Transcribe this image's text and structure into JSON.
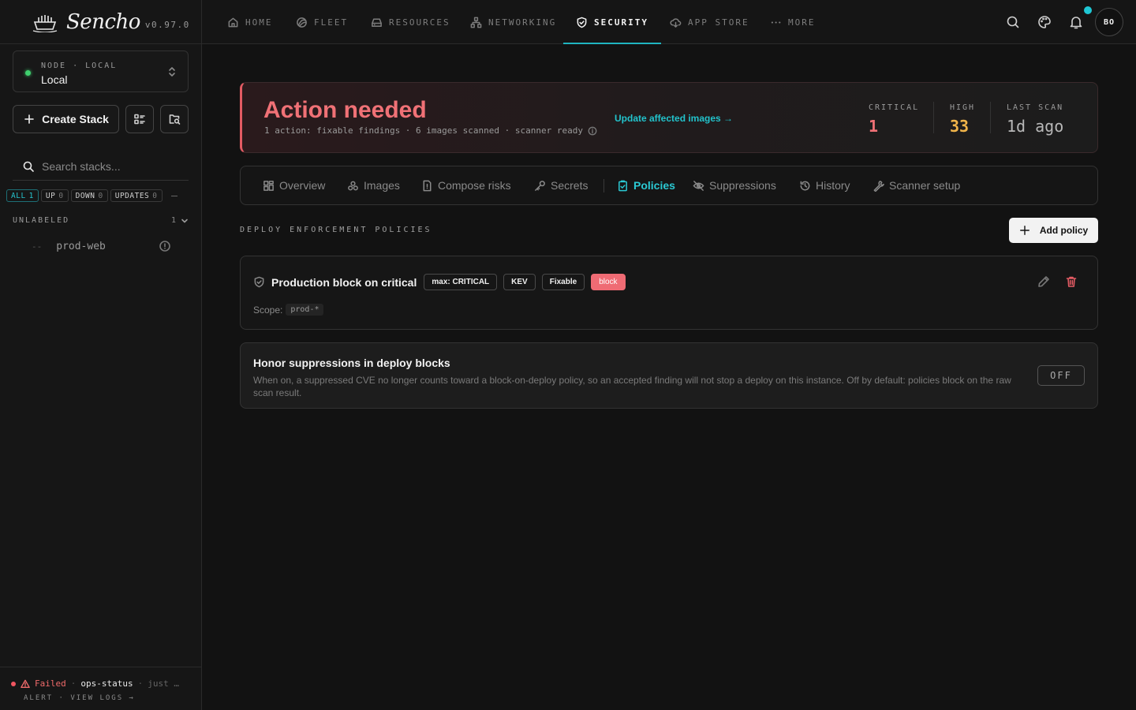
{
  "brand": {
    "name": "Sencho",
    "version": "v0.97.0"
  },
  "node": {
    "label": "NODE · LOCAL",
    "value": "Local"
  },
  "sidebar": {
    "create_label": "Create Stack",
    "search_placeholder": "Search stacks...",
    "filters": [
      {
        "label": "ALL",
        "count": "1"
      },
      {
        "label": "UP",
        "count": "0"
      },
      {
        "label": "DOWN",
        "count": "0"
      },
      {
        "label": "UPDATES",
        "count": "0"
      }
    ],
    "group": {
      "label": "UNLABELED",
      "count": "1"
    },
    "stacks": [
      {
        "dash": "--",
        "name": "prod-web"
      }
    ],
    "footer": {
      "status": "Failed",
      "sep": "·",
      "name": "ops-status",
      "time": "just …",
      "actions": "ALERT · VIEW LOGS →"
    }
  },
  "nav": {
    "items": [
      {
        "label": "HOME",
        "icon": "home-icon"
      },
      {
        "label": "FLEET",
        "icon": "fleet-icon"
      },
      {
        "label": "RESOURCES",
        "icon": "resources-icon"
      },
      {
        "label": "NETWORKING",
        "icon": "networking-icon"
      },
      {
        "label": "SECURITY",
        "icon": "shield-icon"
      },
      {
        "label": "APP STORE",
        "icon": "cloud-download-icon"
      },
      {
        "label": "MORE",
        "icon": "dots-icon"
      }
    ],
    "active": "SECURITY",
    "avatar": "BO"
  },
  "banner": {
    "title": "Action needed",
    "subtitle": "1 action: fixable findings · 6 images scanned · scanner ready",
    "link": "Update affected images →",
    "stats": [
      {
        "label": "CRITICAL",
        "value": "1",
        "color": "#f07176"
      },
      {
        "label": "HIGH",
        "value": "33",
        "color": "#f0b44a"
      },
      {
        "label": "LAST SCAN",
        "value": "1d ago",
        "color": "#b8b8b8"
      }
    ]
  },
  "tabs": {
    "items": [
      {
        "label": "Overview",
        "icon": "grid-icon"
      },
      {
        "label": "Images",
        "icon": "layers-icon"
      },
      {
        "label": "Compose risks",
        "icon": "file-alert-icon"
      },
      {
        "label": "Secrets",
        "icon": "key-icon"
      },
      {
        "label": "Policies",
        "icon": "clipboard-check-icon"
      },
      {
        "label": "Suppressions",
        "icon": "eye-off-icon"
      },
      {
        "label": "History",
        "icon": "history-icon"
      },
      {
        "label": "Scanner setup",
        "icon": "wrench-icon"
      }
    ],
    "active": "Policies"
  },
  "section": {
    "title": "DEPLOY ENFORCEMENT POLICIES",
    "add_label": "Add policy"
  },
  "policy": {
    "name": "Production block on critical",
    "badges": [
      "max: CRITICAL",
      "KEV",
      "Fixable",
      "block"
    ],
    "scope_label": "Scope:",
    "scope_value": "prod-*"
  },
  "honor": {
    "title": "Honor suppressions in deploy blocks",
    "description": "When on, a suppressed CVE no longer counts toward a block-on-deploy policy, so an accepted finding will not stop a deploy on this instance. Off by default: policies block on the raw scan result.",
    "toggle": "OFF"
  }
}
